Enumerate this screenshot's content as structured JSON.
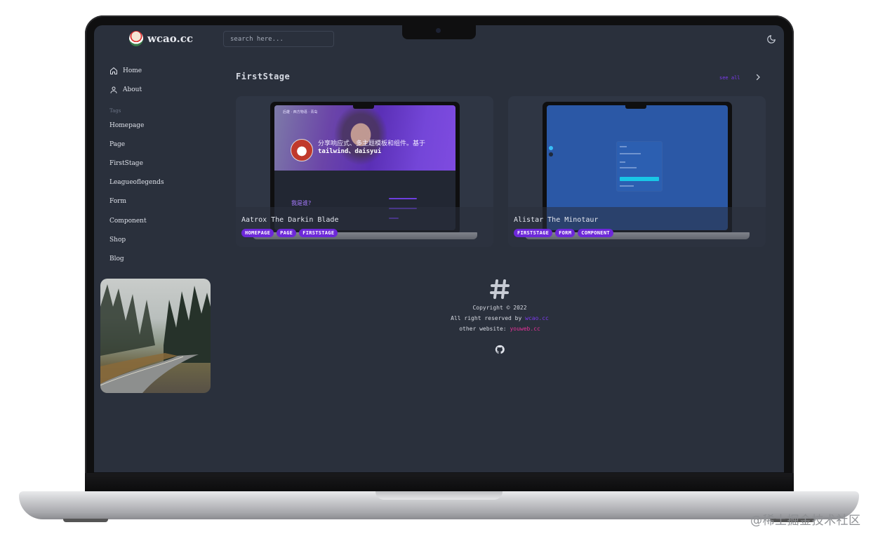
{
  "brand": {
    "name": "wcao.cc"
  },
  "search": {
    "placeholder": "search here..."
  },
  "sidebar": {
    "nav": [
      {
        "label": "Home"
      },
      {
        "label": "About"
      }
    ],
    "tags_title": "Tags",
    "tags": [
      {
        "label": "Homepage"
      },
      {
        "label": "Page"
      },
      {
        "label": "FirstStage"
      },
      {
        "label": "Leagueoflegends"
      },
      {
        "label": "Form"
      },
      {
        "label": "Component"
      },
      {
        "label": "Shop"
      },
      {
        "label": "Blog"
      }
    ]
  },
  "section": {
    "title": "FirstStage",
    "see_all": "see all"
  },
  "cards": [
    {
      "title": "Aatrox The Darkin Blade",
      "tags": [
        "HOMEPAGE",
        "PAGE",
        "FIRSTSTAGE"
      ],
      "shot": {
        "nav": "后雄 · 西方物语 · 青岛",
        "hero_text": "分享响应式、多主题模板和组件。基于",
        "hero_text2": "tailwind、daisyui",
        "who": "我是谁?"
      }
    },
    {
      "title": "Alistar The Minotaur",
      "tags": [
        "FIRSTSTAGE",
        "FORM",
        "COMPONENT"
      ]
    }
  ],
  "footer": {
    "copyright": "Copyright © 2022",
    "reserved_prefix": "All right reserved by ",
    "reserved_link": "wcao.cc",
    "other_prefix": "other website: ",
    "other_link": "youweb.cc"
  },
  "watermark": "@稀土掘金技术社区",
  "colors": {
    "accent": "#7c3aed",
    "chip": "#6d28d9",
    "link_pink": "#e8329a",
    "bg": "#2a303c"
  },
  "icons": {
    "theme": "moon-icon",
    "nav_home": "home-icon",
    "nav_about": "user-icon",
    "see_all": "chevron-right-icon",
    "footer": "hashtag-icon",
    "github": "github-icon"
  }
}
